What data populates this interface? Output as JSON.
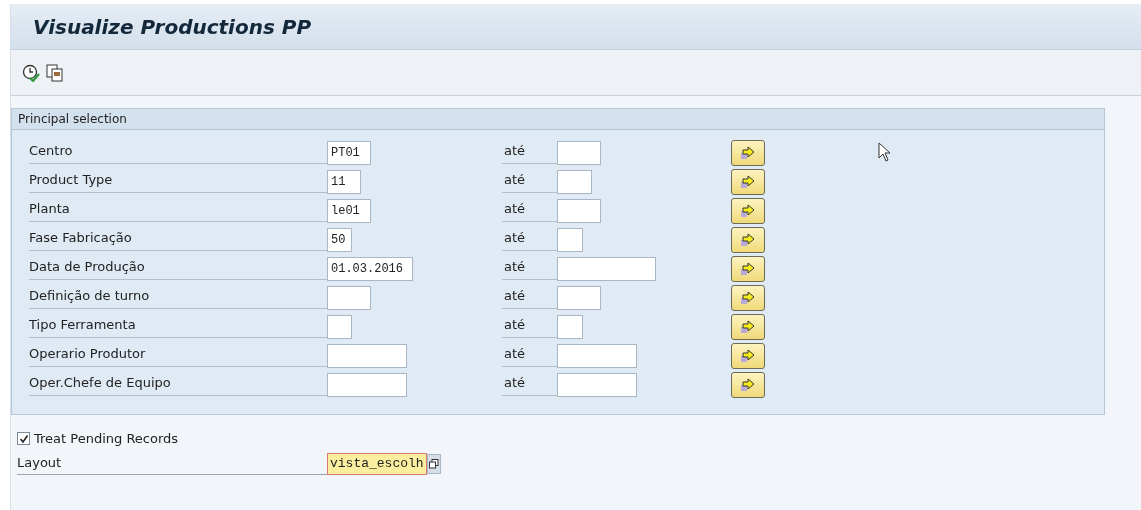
{
  "window": {
    "title": "Visualize Productions PP"
  },
  "toolbar": {
    "buttons": [
      {
        "kind": "execute"
      },
      {
        "kind": "copy"
      }
    ]
  },
  "selection": {
    "title": "Principal selection",
    "rows": [
      {
        "label": "Centro",
        "low": "PT01",
        "to_label": "até",
        "high": ""
      },
      {
        "label": "Product Type",
        "low": "11",
        "to_label": "até",
        "high": ""
      },
      {
        "label": "Planta",
        "low": "le01",
        "to_label": "até",
        "high": ""
      },
      {
        "label": "Fase Fabricação",
        "low": "50",
        "to_label": "até",
        "high": ""
      },
      {
        "label": "Data de Produção",
        "low": "01.03.2016",
        "to_label": "até",
        "high": ""
      },
      {
        "label": "Definição de turno",
        "low": "",
        "to_label": "até",
        "high": ""
      },
      {
        "label": "Tipo Ferramenta",
        "low": "",
        "to_label": "até",
        "high": ""
      },
      {
        "label": "Operario Produtor",
        "low": "",
        "to_label": "até",
        "high": ""
      },
      {
        "label": "Oper.Chefe de Equipo",
        "low": "",
        "to_label": "até",
        "high": ""
      }
    ]
  },
  "treat_pending": {
    "label": "Treat Pending Records",
    "checked": true
  },
  "layout": {
    "label": "Layout",
    "value": "vista_escolh",
    "focused": true
  }
}
